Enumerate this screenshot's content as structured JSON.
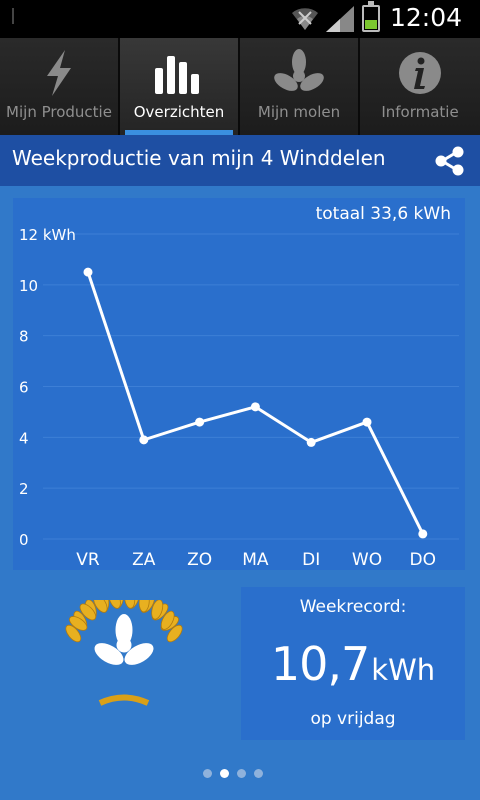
{
  "status_bar": {
    "time": "12:04"
  },
  "tabs": [
    {
      "label": "Mijn Productie",
      "icon": "lightning-icon",
      "active": false
    },
    {
      "label": "Overzichten",
      "icon": "bar-chart-icon",
      "active": true
    },
    {
      "label": "Mijn molen",
      "icon": "windmill-icon",
      "active": false
    },
    {
      "label": "Informatie",
      "icon": "info-icon",
      "active": false
    }
  ],
  "header": {
    "title": "Weekproductie van mijn 4 Winddelen",
    "share_icon": "share-icon"
  },
  "chart": {
    "total_label": "totaal 33,6 kWh"
  },
  "chart_data": {
    "type": "line",
    "categories": [
      "VR",
      "ZA",
      "ZO",
      "MA",
      "DI",
      "WO",
      "DO"
    ],
    "values": [
      10.5,
      3.9,
      4.6,
      5.2,
      3.8,
      4.6,
      0.2
    ],
    "ylabel": "kWh",
    "ytick_labels": [
      "0",
      "2",
      "4",
      "6",
      "8",
      "10",
      "12 kWh"
    ],
    "yticks": [
      0,
      2,
      4,
      6,
      8,
      10,
      12
    ],
    "ylim": [
      0,
      12
    ],
    "grid": true,
    "colors": {
      "line": "#ffffff",
      "grid": "#3d7fd6"
    }
  },
  "record": {
    "label": "Weekrecord:",
    "value": "10,7",
    "unit": "kWh",
    "sub": "op vrijdag",
    "icon": "trophy-windmill-icon"
  },
  "pager": {
    "count": 4,
    "active_index": 1
  },
  "colors": {
    "background": "#3179c9",
    "panel": "#2a6fcc",
    "header": "#1e4fa3",
    "tab_indicator": "#3a8fe0",
    "laurel": "#e8b020"
  }
}
